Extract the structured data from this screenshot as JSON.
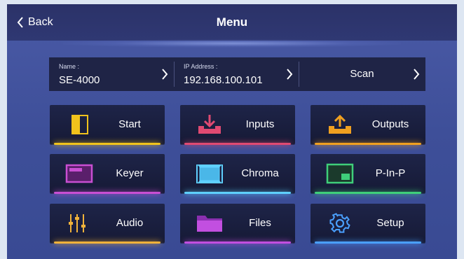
{
  "header": {
    "back_label": "Back",
    "title": "Menu"
  },
  "info": {
    "name_label": "Name :",
    "name_value": "SE-4000",
    "ip_label": "IP Address :",
    "ip_value": "192.168.100.101",
    "scan_label": "Scan"
  },
  "buttons": [
    {
      "label": "Start",
      "icon": "start-icon",
      "glow": "#f0c21c"
    },
    {
      "label": "Inputs",
      "icon": "download-tray-icon",
      "glow": "#e04a72"
    },
    {
      "label": "Outputs",
      "icon": "upload-tray-icon",
      "glow": "#f0a020"
    },
    {
      "label": "Keyer",
      "icon": "keyer-icon",
      "glow": "#c94fd3"
    },
    {
      "label": "Chroma",
      "icon": "chroma-icon",
      "glow": "#5fd0ff"
    },
    {
      "label": "P-In-P",
      "icon": "picture-in-picture-icon",
      "glow": "#3fcf7a"
    },
    {
      "label": "Audio",
      "icon": "audio-mixer-icon",
      "glow": "#f0b23a"
    },
    {
      "label": "Files",
      "icon": "folder-icon",
      "glow": "#c24fe0"
    },
    {
      "label": "Setup",
      "icon": "gear-icon",
      "glow": "#4aa0ff"
    }
  ],
  "colors": {
    "background": "#4a5aa6",
    "topbar": "#2b3268",
    "tile": "#1e2448",
    "yellow": "#f0c21c",
    "pink": "#e04a72",
    "orange": "#f0a020",
    "magenta": "#c94fd3",
    "cyan": "#5fd0ff",
    "green": "#3fcf7a",
    "purple": "#c24fe0",
    "blue": "#4aa0ff"
  }
}
